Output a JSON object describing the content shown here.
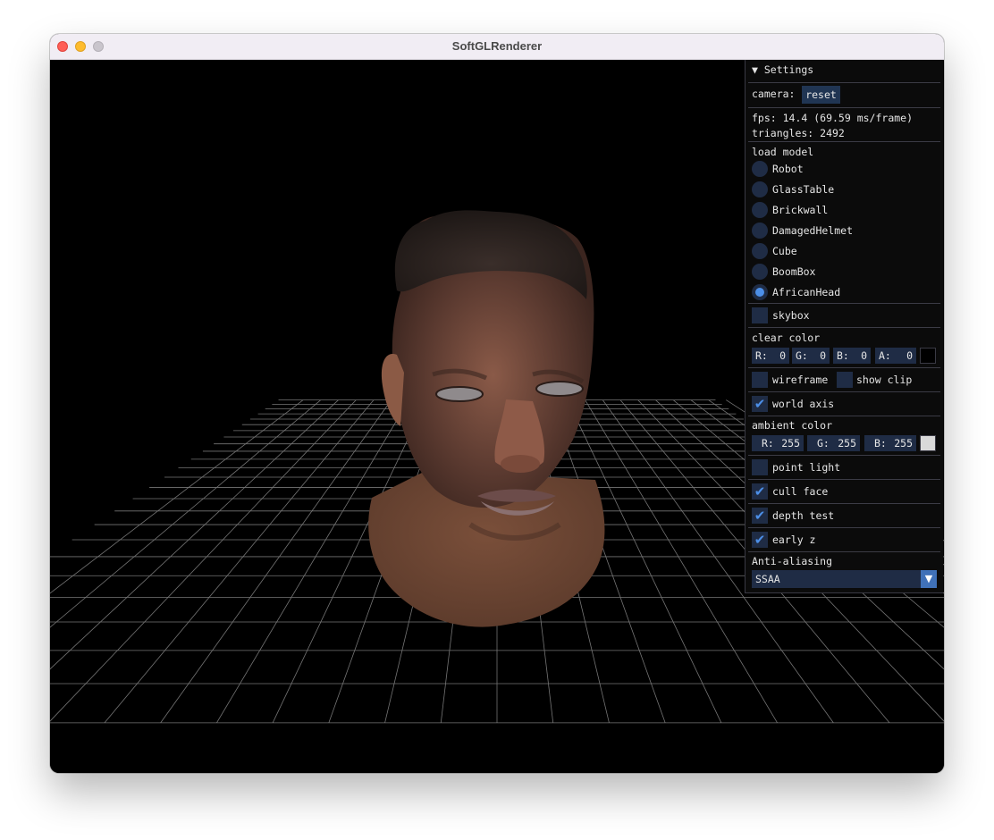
{
  "window": {
    "title": "SoftGLRenderer"
  },
  "panel": {
    "header": "▼ Settings",
    "camera_label": "camera:",
    "reset_label": "reset",
    "fps_text": "fps: 14.4 (69.59 ms/frame)",
    "triangles_text": "triangles: 2492",
    "load_model_label": "load model",
    "models": [
      "Robot",
      "GlassTable",
      "Brickwall",
      "DamagedHelmet",
      "Cube",
      "BoomBox",
      "AfricanHead"
    ],
    "selected_model": "AfricanHead",
    "skybox_label": "skybox",
    "skybox_checked": false,
    "clear_color_label": "clear color",
    "clear_color": [
      {
        "label": "R:",
        "value": "0"
      },
      {
        "label": "G:",
        "value": "0"
      },
      {
        "label": "B:",
        "value": "0"
      },
      {
        "label": "A:",
        "value": "0"
      }
    ],
    "clear_color_hex": "#000000",
    "wireframe_label": "wireframe",
    "wireframe_checked": false,
    "show_clip_label": "show clip",
    "show_clip_checked": false,
    "world_axis_label": "world axis",
    "world_axis_checked": true,
    "ambient_color_label": "ambient color",
    "ambient_color": [
      {
        "label": "R:",
        "value": "255"
      },
      {
        "label": "G:",
        "value": "255"
      },
      {
        "label": "B:",
        "value": "255"
      }
    ],
    "ambient_color_hex": "#d9d9d9",
    "point_light_label": "point light",
    "point_light_checked": false,
    "cull_face_label": "cull face",
    "cull_face_checked": true,
    "depth_test_label": "depth test",
    "depth_test_checked": true,
    "early_z_label": "early z",
    "early_z_checked": true,
    "anti_aliasing_label": "Anti-aliasing",
    "anti_aliasing_value": "SSAA",
    "accent_color": "#4c8fe8",
    "frame_color": "#1f2c45"
  }
}
